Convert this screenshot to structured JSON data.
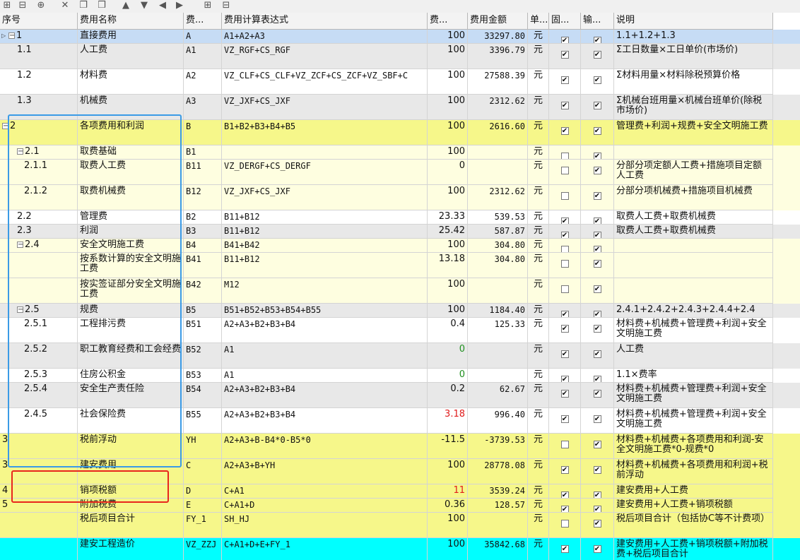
{
  "toolbar": [
    {
      "name": "insert-row-icon",
      "glyph": "⊞"
    },
    {
      "name": "insert-child-icon",
      "glyph": "⊟"
    },
    {
      "name": "add-row-icon",
      "glyph": "⊕"
    },
    {
      "name": "delete-icon",
      "glyph": "✕"
    },
    {
      "name": "copy-icon",
      "glyph": "❐"
    },
    {
      "name": "paste-icon",
      "glyph": "❒"
    },
    {
      "name": "move-up-icon",
      "glyph": "▲"
    },
    {
      "name": "move-down-icon",
      "glyph": "▼"
    },
    {
      "name": "arrow-left-icon",
      "glyph": "◀"
    },
    {
      "name": "arrow-right-icon",
      "glyph": "▶"
    },
    {
      "name": "expand-icon",
      "glyph": "⊞"
    },
    {
      "name": "collapse-icon",
      "glyph": "⊟"
    }
  ],
  "columns": [
    {
      "key": "seq",
      "label": "序号"
    },
    {
      "key": "name",
      "label": "费用名称"
    },
    {
      "key": "code",
      "label": "费..."
    },
    {
      "key": "expr",
      "label": "费用计算表达式"
    },
    {
      "key": "rate",
      "label": "费..."
    },
    {
      "key": "amount",
      "label": "费用金额"
    },
    {
      "key": "unit",
      "label": "单..."
    },
    {
      "key": "fixed",
      "label": "固..."
    },
    {
      "key": "output",
      "label": "输..."
    },
    {
      "key": "desc",
      "label": "说明"
    }
  ],
  "colors": {
    "blue_row": "#c6dcf5",
    "yellow_row": "#f6f78a",
    "light_yellow_row": "#fefee0",
    "gray_row": "#e8e8e8",
    "cyan_row": "#00ffff",
    "white_row": "#ffffff",
    "header": "#f3f3f3",
    "blue_box": "#3b9be6",
    "red_box": "#e8261c"
  },
  "rows": [
    {
      "seq": "1",
      "name": "直接费用",
      "code": "A",
      "expr": "A1+A2+A3",
      "rate": "100",
      "amount": "33297.80",
      "unit": "元",
      "fixed": true,
      "output": true,
      "desc": "1.1+1.2+1.3",
      "toggle": "minus",
      "indicator": "▷",
      "bg": "blue_row"
    },
    {
      "seq": "1.1",
      "name": "人工费",
      "code": "A1",
      "expr": "VZ_RGF+CS_RGF",
      "rate": "100",
      "amount": "3396.79",
      "unit": "元",
      "fixed": true,
      "output": true,
      "desc": "Σ工日数量×工日单价(市场价)",
      "bg": "gray_row"
    },
    {
      "seq": "1.2",
      "name": "材料费",
      "code": "A2",
      "expr": "VZ_CLF+CS_CLF+VZ_ZCF+CS_ZCF+VZ_SBF+C",
      "rate": "100",
      "amount": "27588.39",
      "unit": "元",
      "fixed": true,
      "output": true,
      "desc": "Σ材料用量×材料除税预算价格",
      "bg": "white_row"
    },
    {
      "seq": "1.3",
      "name": "机械费",
      "code": "A3",
      "expr": "VZ_JXF+CS_JXF",
      "rate": "100",
      "amount": "2312.62",
      "unit": "元",
      "fixed": true,
      "output": true,
      "desc": "Σ机械台班用量×机械台班单价(除税市场价)",
      "bg": "gray_row"
    },
    {
      "seq": "2",
      "name": "各项费用和利润",
      "code": "B",
      "expr": "B1+B2+B3+B4+B5",
      "rate": "100",
      "amount": "2616.60",
      "unit": "元",
      "fixed": true,
      "output": true,
      "desc": "管理费+利润+规费+安全文明施工费",
      "toggle": "minus",
      "bg": "yellow_row"
    },
    {
      "seq": "2.1",
      "name": "取费基础",
      "code": "B1",
      "expr": "",
      "rate": "100",
      "amount": "",
      "unit": "元",
      "fixed": false,
      "output": true,
      "desc": "",
      "toggle": "minus",
      "bg": "light_yellow_row"
    },
    {
      "seq": "2.1.1",
      "name": "取费人工费",
      "code": "B11",
      "expr": "VZ_DERGF+CS_DERGF",
      "rate": "0",
      "amount": "",
      "unit": "元",
      "fixed": false,
      "output": true,
      "desc": "分部分项定额人工费+措施项目定额人工费",
      "bg": "light_yellow_row"
    },
    {
      "seq": "2.1.2",
      "name": "取费机械费",
      "code": "B12",
      "expr": "VZ_JXF+CS_JXF",
      "rate": "100",
      "amount": "2312.62",
      "unit": "元",
      "fixed": false,
      "output": true,
      "desc": "分部分项机械费+措施项目机械费",
      "bg": "light_yellow_row"
    },
    {
      "seq": "2.2",
      "name": "管理费",
      "code": "B2",
      "expr": "B11+B12",
      "rate": "23.33",
      "amount": "539.53",
      "unit": "元",
      "fixed": true,
      "output": true,
      "desc": "取费人工费+取费机械费",
      "bg": "white_row"
    },
    {
      "seq": "2.3",
      "name": "利润",
      "code": "B3",
      "expr": "B11+B12",
      "rate": "25.42",
      "amount": "587.87",
      "unit": "元",
      "fixed": true,
      "output": true,
      "desc": "取费人工费+取费机械费",
      "bg": "gray_row"
    },
    {
      "seq": "2.4",
      "name": "安全文明施工费",
      "code": "B4",
      "expr": "B41+B42",
      "rate": "100",
      "amount": "304.80",
      "unit": "元",
      "fixed": false,
      "output": true,
      "desc": "",
      "toggle": "minus",
      "bg": "light_yellow_row"
    },
    {
      "seq": "",
      "name": "按系数计算的安全文明施工费",
      "code": "B41",
      "expr": "B11+B12",
      "rate": "13.18",
      "amount": "304.80",
      "unit": "元",
      "fixed": false,
      "output": true,
      "desc": "",
      "bg": "light_yellow_row"
    },
    {
      "seq": "",
      "name": "按实签证部分安全文明施工费",
      "code": "B42",
      "expr": "M12",
      "rate": "100",
      "amount": "",
      "unit": "元",
      "fixed": false,
      "output": true,
      "desc": "",
      "bg": "light_yellow_row"
    },
    {
      "seq": "2.5",
      "name": "规费",
      "code": "B5",
      "expr": "B51+B52+B53+B54+B55",
      "rate": "100",
      "amount": "1184.40",
      "unit": "元",
      "fixed": true,
      "output": true,
      "desc": "2.4.1+2.4.2+2.4.3+2.4.4+2.4",
      "toggle": "minus",
      "bg": "gray_row"
    },
    {
      "seq": "2.5.1",
      "name": "工程排污费",
      "code": "B51",
      "expr": "A2+A3+B2+B3+B4",
      "rate": "0.4",
      "amount": "125.33",
      "unit": "元",
      "fixed": true,
      "output": true,
      "desc": "材料费+机械费+管理费+利润+安全文明施工费",
      "bg": "white_row"
    },
    {
      "seq": "2.5.2",
      "name": "职工教育经费和工会经费",
      "code": "B52",
      "expr": "A1",
      "rate": "0",
      "rate_color": "green",
      "amount": "",
      "unit": "元",
      "fixed": true,
      "output": true,
      "desc": "人工费",
      "bg": "gray_row"
    },
    {
      "seq": "2.5.3",
      "name": "住房公积金",
      "code": "B53",
      "expr": "A1",
      "rate": "0",
      "rate_color": "green",
      "amount": "",
      "unit": "元",
      "fixed": true,
      "output": true,
      "desc": "1.1×费率",
      "bg": "white_row"
    },
    {
      "seq": "2.5.4",
      "name": "安全生产责任险",
      "code": "B54",
      "expr": "A2+A3+B2+B3+B4",
      "rate": "0.2",
      "amount": "62.67",
      "unit": "元",
      "fixed": true,
      "output": true,
      "desc": "材料费+机械费+管理费+利润+安全文明施工费",
      "bg": "gray_row"
    },
    {
      "seq": "2.4.5",
      "name": "社会保险费",
      "code": "B55",
      "expr": "A2+A3+B2+B3+B4",
      "rate": "3.18",
      "rate_color": "red",
      "amount": "996.40",
      "unit": "元",
      "fixed": true,
      "output": true,
      "desc": "材料费+机械费+管理费+利润+安全文明施工费",
      "bg": "white_row"
    },
    {
      "seq": "3",
      "name": "税前浮动",
      "code": "YH",
      "expr": "A2+A3+B-B4*0-B5*0",
      "rate": "-11.5",
      "amount": "-3739.53",
      "unit": "元",
      "fixed": false,
      "output": true,
      "desc": "材料费+机械费+各项费用和利润-安全文明施工费*0-规费*0",
      "bg": "yellow_row"
    },
    {
      "seq": "3",
      "name": "建安费用",
      "code": "C",
      "expr": "A2+A3+B+YH",
      "rate": "100",
      "amount": "28778.08",
      "unit": "元",
      "fixed": true,
      "output": true,
      "desc": "材料费+机械费+各项费用和利润+税前浮动",
      "bg": "yellow_row"
    },
    {
      "seq": "4",
      "name": "销项税额",
      "code": "D",
      "expr": "C+A1",
      "rate": "11",
      "rate_color": "red",
      "amount": "3539.24",
      "unit": "元",
      "fixed": true,
      "output": true,
      "desc": "建安费用+人工费",
      "bg": "yellow_row"
    },
    {
      "seq": "5",
      "name": "附加税费",
      "code": "E",
      "expr": "C+A1+D",
      "rate": "0.36",
      "amount": "128.57",
      "unit": "元",
      "fixed": true,
      "output": true,
      "desc": "建安费用+人工费+销项税额",
      "bg": "yellow_row"
    },
    {
      "seq": "",
      "name": "税后项目合计",
      "code": "FY_1",
      "expr": "SH_HJ",
      "rate": "100",
      "amount": "",
      "unit": "元",
      "fixed": false,
      "output": true,
      "desc": "税后项目合计（包括协C等不计费项）",
      "bg": "yellow_row"
    },
    {
      "seq": "",
      "name": "建安工程造价",
      "code": "VZ_ZZJ",
      "expr": "C+A1+D+E+FY_1",
      "rate": "100",
      "amount": "35842.68",
      "unit": "元",
      "fixed": true,
      "output": true,
      "desc": "建安费用+人工费+销项税额+附加税费+税后项目合计",
      "bg": "cyan_row"
    }
  ]
}
